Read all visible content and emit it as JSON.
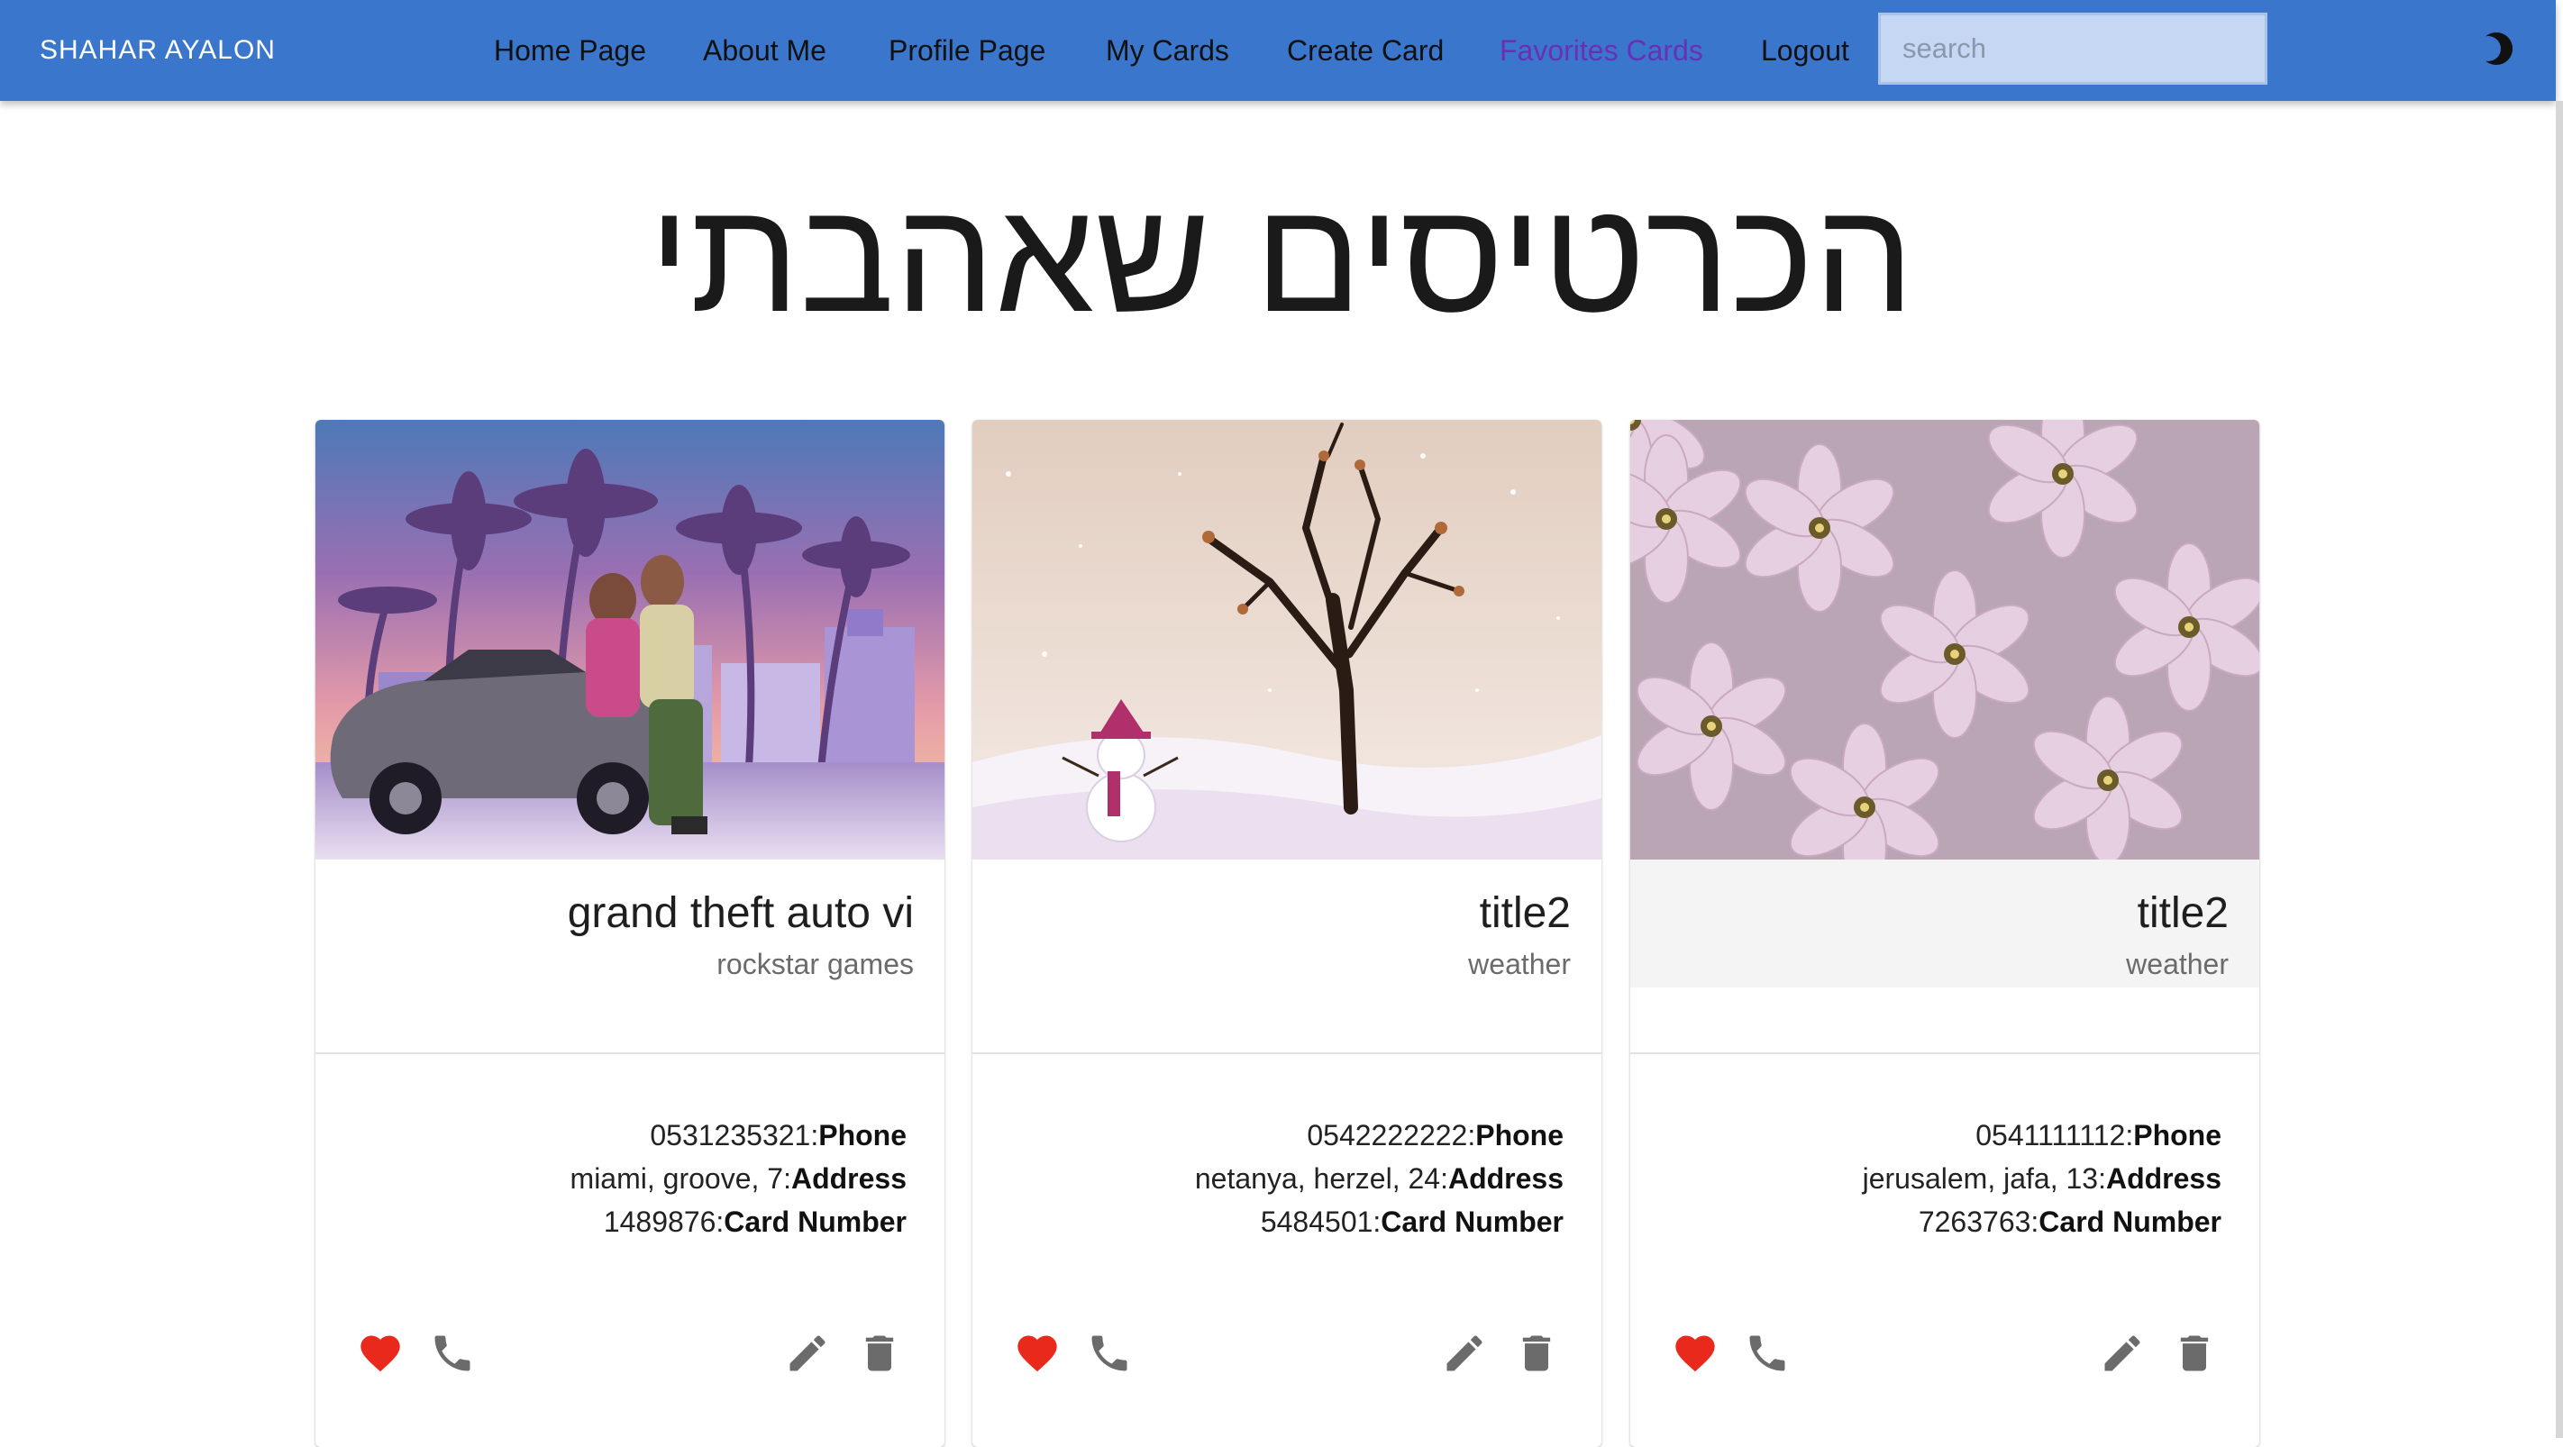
{
  "nav": {
    "brand": "SHAHAR AYALON",
    "links": [
      "Home Page",
      "About Me",
      "Profile Page",
      "My Cards",
      "Create Card",
      "Favorites Cards",
      "Logout"
    ],
    "active_index": 5,
    "active_color": "#6a2fb5",
    "search_placeholder": "search",
    "theme_icon": "moon-icon",
    "bar_color": "#3a76cc"
  },
  "page": {
    "title": "הכרטיסים שאהבתי"
  },
  "cards": [
    {
      "title": "grand theft auto vi",
      "subtitle": "rockstar games",
      "phone_value": "0531235321:",
      "phone_label": "Phone",
      "address_value": "miami, groove, 7:",
      "address_label": "Address",
      "number_value": "1489876:",
      "number_label": "Card Number",
      "image": "gta-vi-artwork",
      "favorite": true
    },
    {
      "title": "title2",
      "subtitle": "weather",
      "phone_value": "0542222222:",
      "phone_label": "Phone",
      "address_value": "netanya, herzel, 24:",
      "address_label": "Address",
      "number_value": "5484501:",
      "number_label": "Card Number",
      "image": "winter-tree-snowman",
      "favorite": true
    },
    {
      "title": "title2",
      "subtitle": "weather",
      "phone_value": "0541111112:",
      "phone_label": "Phone",
      "address_value": "jerusalem, jafa, 13:",
      "address_label": "Address",
      "number_value": "7263763:",
      "number_label": "Card Number",
      "image": "pink-hyacinth-flowers",
      "favorite": true
    }
  ],
  "colors": {
    "heart": "#e8291c",
    "icon_gray": "#6b6b6b"
  }
}
